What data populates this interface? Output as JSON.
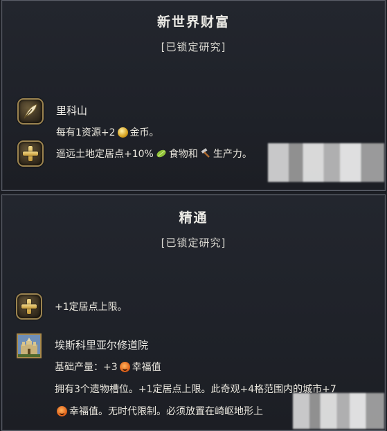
{
  "panels": [
    {
      "title": "新世界财富",
      "subtitle": "[已锁定研究]",
      "entries": [
        {
          "icon": "feather-icon",
          "name": "里科山",
          "line": {
            "a": "每有1资源+2",
            "resource": "gold-icon",
            "b": "金币。"
          }
        },
        {
          "icon": "plus-icon",
          "line": {
            "a": "遥远土地定居点+10%",
            "r1": "food-icon",
            "b": "食物和",
            "r2": "hammer-icon",
            "c": "生产力。"
          }
        }
      ]
    },
    {
      "title": "精通",
      "subtitle": "[已锁定研究]",
      "entries": [
        {
          "icon": "plus-icon",
          "line": "+1定居点上限。"
        },
        {
          "icon": "wonder-icon",
          "name": "埃斯科里亚尔修道院",
          "yield": {
            "a": "基础产量：+3",
            "resource": "happy-icon",
            "b": "幸福值"
          },
          "desc1": "拥有3个遗物槽位。+1定居点上限。此奇观+4格范围内的城市+7",
          "desc2": {
            "resource": "happy-icon",
            "a": "幸福值。无时代限制。必须放置在崎岖地形上"
          }
        }
      ]
    }
  ],
  "colors": {
    "panel_bg": "#23262e",
    "border": "#5a5e68",
    "icon_frame": "#9c8450",
    "gold": "#d7a21f",
    "happiness": "#e0621a"
  }
}
